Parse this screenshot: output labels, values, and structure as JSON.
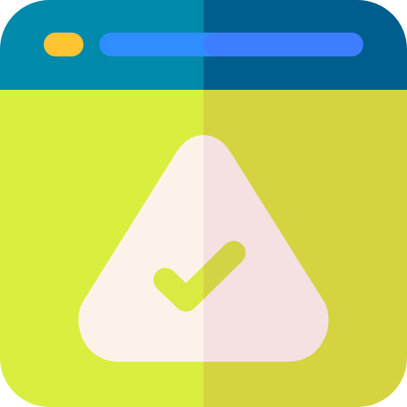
{
  "icon": {
    "name": "browser-window-warning-check-icon",
    "parts": {
      "titlebar": "window-titlebar",
      "window_dot": "window-control-dot",
      "address_bar": "address-bar",
      "content_area": "window-content",
      "warning_triangle": "warning-triangle-icon",
      "checkmark": "checkmark-icon"
    }
  },
  "colors": {
    "titlebar_left": "#0089AA",
    "titlebar_right": "#005E8E",
    "dot": "#FFC431",
    "address_left": "#2E8DFF",
    "address_right": "#3D7DFF",
    "content_left": "#DAEE40",
    "content_right": "#D5D340",
    "triangle_left": "#FDF2EA",
    "triangle_right": "#F5E1E1",
    "check_left": "#D9EA42",
    "check_right": "#D4D345"
  }
}
